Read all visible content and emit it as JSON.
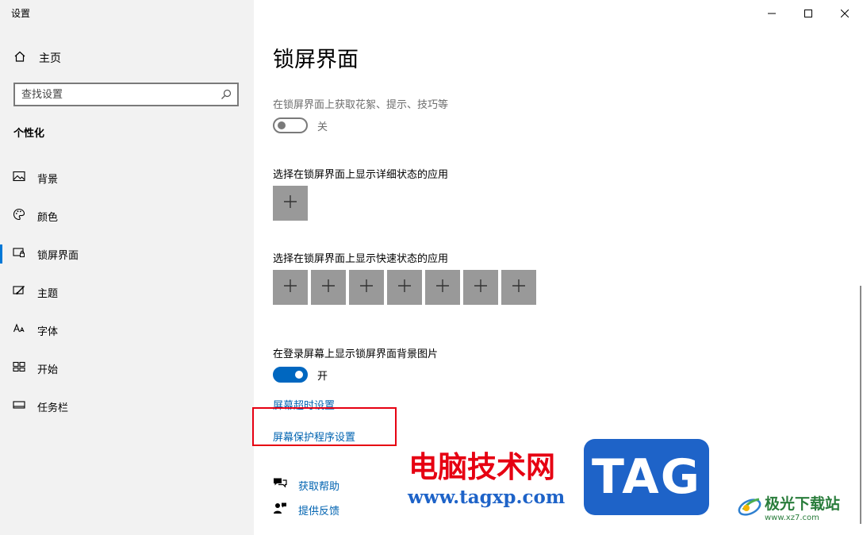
{
  "window": {
    "title": "设置"
  },
  "sidebar": {
    "home_label": "主页",
    "search": {
      "placeholder": "查找设置",
      "value": ""
    },
    "section_title": "个性化",
    "items": [
      {
        "label": "背景",
        "icon": "picture-icon",
        "active": false
      },
      {
        "label": "颜色",
        "icon": "palette-icon",
        "active": false
      },
      {
        "label": "锁屏界面",
        "icon": "lock-screen-icon",
        "active": true
      },
      {
        "label": "主题",
        "icon": "theme-icon",
        "active": false
      },
      {
        "label": "字体",
        "icon": "font-icon",
        "active": false
      },
      {
        "label": "开始",
        "icon": "start-icon",
        "active": false
      },
      {
        "label": "任务栏",
        "icon": "taskbar-icon",
        "active": false
      }
    ]
  },
  "main": {
    "title": "锁屏界面",
    "fun_facts": {
      "label": "在锁屏界面上获取花絮、提示、技巧等",
      "state": "关"
    },
    "detailed_status": {
      "label": "选择在锁屏界面上显示详细状态的应用"
    },
    "quick_status": {
      "label": "选择在锁屏界面上显示快速状态的应用"
    },
    "show_background": {
      "label": "在登录屏幕上显示锁屏界面背景图片",
      "state": "开"
    },
    "links": {
      "screen_timeout": "屏幕超时设置",
      "screensaver": "屏幕保护程序设置"
    },
    "help": {
      "get_help": "获取帮助",
      "feedback": "提供反馈"
    }
  },
  "watermark": {
    "text": "电脑技术网",
    "url": "www.tagxp.com",
    "tag": "TAG",
    "logo_text": "极光下载站",
    "logo_url": "www.xz7.com"
  },
  "colors": {
    "accent": "#0067c0",
    "link": "#0063b1",
    "sidebar_bg": "#f2f2f2",
    "tile_gray": "#999999",
    "highlight_red": "#e60012"
  }
}
